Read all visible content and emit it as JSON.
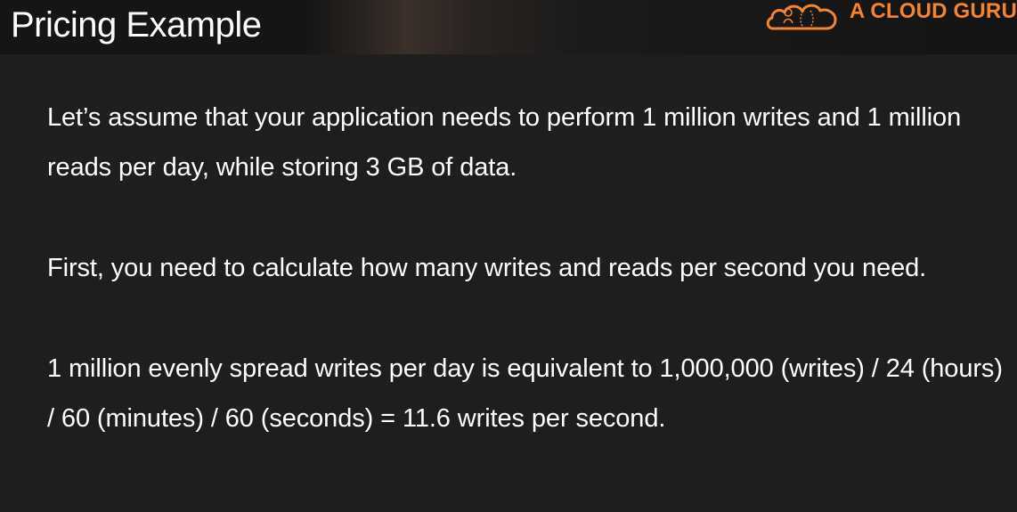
{
  "slide": {
    "title": "Pricing Example",
    "brand": {
      "name": "A CLOUD GURU",
      "logo_icon": "cloud-guru-logo-icon",
      "accent_color": "#f2852e"
    },
    "paragraphs": [
      "Let’s assume that your application needs to perform 1 million writes and 1 million reads per day, while storing 3 GB of data.",
      "First, you need to calculate how many writes and reads per second you need.",
      "1 million evenly spread writes per day is equivalent to 1,000,000 (writes) / 24 (hours) / 60 (minutes) / 60 (seconds) = 11.6 writes per second."
    ],
    "background_color": "#1e1e1e",
    "text_color": "#ffffff"
  }
}
